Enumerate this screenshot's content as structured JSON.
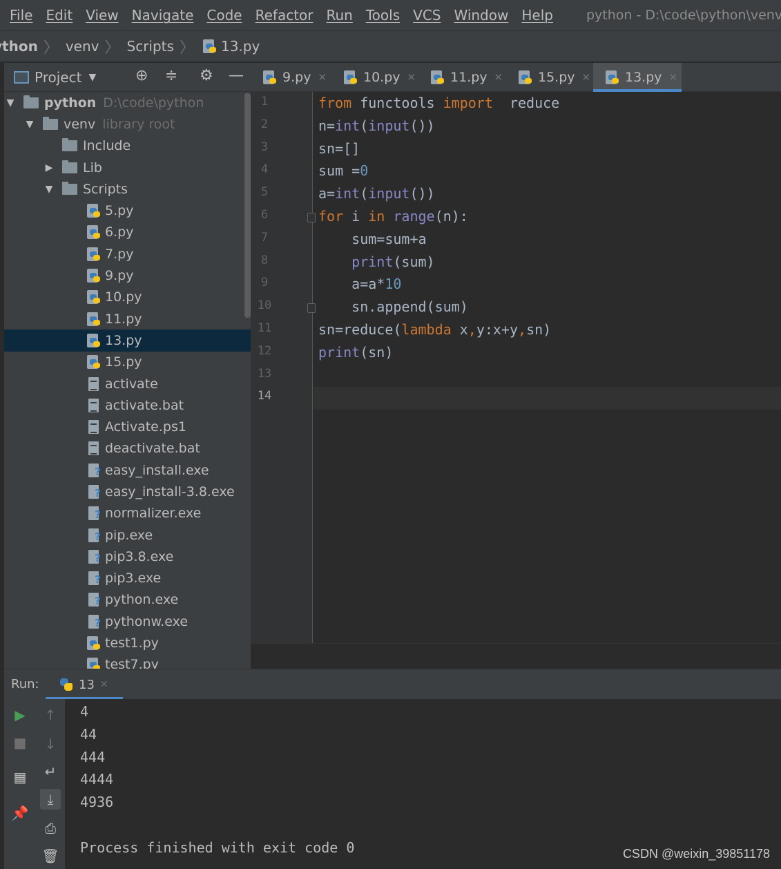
{
  "menu": {
    "items": [
      "File",
      "Edit",
      "View",
      "Navigate",
      "Code",
      "Refactor",
      "Run",
      "Tools",
      "VCS",
      "Window",
      "Help"
    ],
    "window_title": "python - D:\\code\\python\\venv\\Scri"
  },
  "breadcrumb": {
    "items": [
      "ython",
      "venv",
      "Scripts",
      "13.py"
    ]
  },
  "project_panel": {
    "title": "Project",
    "tree": [
      {
        "label": "python",
        "hint": "D:\\code\\python",
        "type": "folder",
        "depth": 0,
        "expanded": true
      },
      {
        "label": "venv",
        "hint": "library root",
        "type": "folder",
        "depth": 1,
        "expanded": true
      },
      {
        "label": "Include",
        "type": "folder",
        "depth": 2
      },
      {
        "label": "Lib",
        "type": "folder",
        "depth": 2,
        "expanded": false
      },
      {
        "label": "Scripts",
        "type": "folder",
        "depth": 2,
        "expanded": true
      },
      {
        "label": "5.py",
        "type": "py",
        "depth": 3
      },
      {
        "label": "6.py",
        "type": "py",
        "depth": 3
      },
      {
        "label": "7.py",
        "type": "py",
        "depth": 3
      },
      {
        "label": "9.py",
        "type": "py",
        "depth": 3
      },
      {
        "label": "10.py",
        "type": "py",
        "depth": 3
      },
      {
        "label": "11.py",
        "type": "py",
        "depth": 3
      },
      {
        "label": "13.py",
        "type": "py",
        "depth": 3,
        "selected": true
      },
      {
        "label": "15.py",
        "type": "py",
        "depth": 3
      },
      {
        "label": "activate",
        "type": "txt",
        "depth": 3
      },
      {
        "label": "activate.bat",
        "type": "txt",
        "depth": 3
      },
      {
        "label": "Activate.ps1",
        "type": "txt",
        "depth": 3
      },
      {
        "label": "deactivate.bat",
        "type": "txt",
        "depth": 3
      },
      {
        "label": "easy_install.exe",
        "type": "exe",
        "depth": 3
      },
      {
        "label": "easy_install-3.8.exe",
        "type": "exe",
        "depth": 3
      },
      {
        "label": "normalizer.exe",
        "type": "exe",
        "depth": 3
      },
      {
        "label": "pip.exe",
        "type": "exe",
        "depth": 3
      },
      {
        "label": "pip3.8.exe",
        "type": "exe",
        "depth": 3
      },
      {
        "label": "pip3.exe",
        "type": "exe",
        "depth": 3
      },
      {
        "label": "python.exe",
        "type": "exe",
        "depth": 3
      },
      {
        "label": "pythonw.exe",
        "type": "exe",
        "depth": 3
      },
      {
        "label": "test1.py",
        "type": "py",
        "depth": 3
      },
      {
        "label": "test7.py",
        "type": "py",
        "depth": 3
      }
    ]
  },
  "editor": {
    "tabs": [
      {
        "label": "9.py",
        "active": false
      },
      {
        "label": "10.py",
        "active": false
      },
      {
        "label": "11.py",
        "active": false
      },
      {
        "label": "15.py",
        "active": false
      },
      {
        "label": "13.py",
        "active": true
      }
    ],
    "current_line": 14,
    "lines": [
      [
        [
          "kw",
          "from"
        ],
        [
          "",
          " functools "
        ],
        [
          "kw",
          "import"
        ],
        [
          "",
          "  reduce"
        ]
      ],
      [
        [
          "",
          "n="
        ],
        [
          "bi",
          "int"
        ],
        [
          "",
          "("
        ],
        [
          "bi",
          "input"
        ],
        [
          "",
          "())"
        ]
      ],
      [
        [
          "",
          "sn=[]"
        ]
      ],
      [
        [
          "",
          "sum ="
        ],
        [
          "num",
          "0"
        ]
      ],
      [
        [
          "",
          "a="
        ],
        [
          "bi",
          "int"
        ],
        [
          "",
          "("
        ],
        [
          "bi",
          "input"
        ],
        [
          "",
          "())"
        ]
      ],
      [
        [
          "kw",
          "for"
        ],
        [
          "",
          " i "
        ],
        [
          "kw",
          "in"
        ],
        [
          "",
          " "
        ],
        [
          "bi",
          "range"
        ],
        [
          "",
          "(n):"
        ]
      ],
      [
        [
          "",
          "    sum=sum+a"
        ]
      ],
      [
        [
          "",
          "    "
        ],
        [
          "bi",
          "print"
        ],
        [
          "",
          "(sum)"
        ]
      ],
      [
        [
          "",
          "    a=a*"
        ],
        [
          "num",
          "10"
        ]
      ],
      [
        [
          "",
          "    sn.append(sum)"
        ]
      ],
      [
        [
          "",
          "sn=reduce("
        ],
        [
          "kw",
          "lambda"
        ],
        [
          "",
          " x"
        ],
        [
          "kw",
          ","
        ],
        [
          "",
          "y:x+y"
        ],
        [
          "kw",
          ","
        ],
        [
          "",
          "sn)"
        ]
      ],
      [
        [
          "bi",
          "print"
        ],
        [
          "",
          "(sn)"
        ]
      ],
      [],
      []
    ]
  },
  "run_panel": {
    "label": "Run:",
    "tab": "13",
    "output": [
      "4",
      "44",
      "444",
      "4444",
      "4936",
      "",
      "Process finished with exit code 0"
    ]
  },
  "watermark": "CSDN @weixin_39851178"
}
